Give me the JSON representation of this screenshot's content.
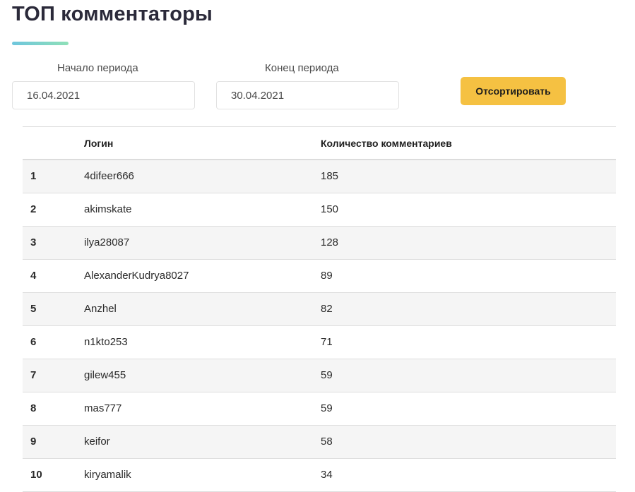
{
  "page": {
    "title": "ТОП комментаторы",
    "accent_gradient": [
      "#6ec6dd",
      "#8fe0b8"
    ]
  },
  "filters": {
    "start_label": "Начало периода",
    "start_value": "16.04.2021",
    "end_label": "Конец периода",
    "end_value": "30.04.2021",
    "sort_button_label": "Отсортировать",
    "sort_button_color": "#f5c142"
  },
  "table": {
    "columns": [
      "",
      "Логин",
      "Количество комментариев"
    ],
    "rows": [
      {
        "rank": "1",
        "login": "4difeer666",
        "count": "185"
      },
      {
        "rank": "2",
        "login": "akimskate",
        "count": "150"
      },
      {
        "rank": "3",
        "login": "ilya28087",
        "count": "128"
      },
      {
        "rank": "4",
        "login": "AlexanderKudrya8027",
        "count": "89"
      },
      {
        "rank": "5",
        "login": "Anzhel",
        "count": "82"
      },
      {
        "rank": "6",
        "login": "n1kto253",
        "count": "71"
      },
      {
        "rank": "7",
        "login": "gilew455",
        "count": "59"
      },
      {
        "rank": "8",
        "login": "mas777",
        "count": "59"
      },
      {
        "rank": "9",
        "login": "keifor",
        "count": "58"
      },
      {
        "rank": "10",
        "login": "kiryamalik",
        "count": "34"
      }
    ]
  }
}
